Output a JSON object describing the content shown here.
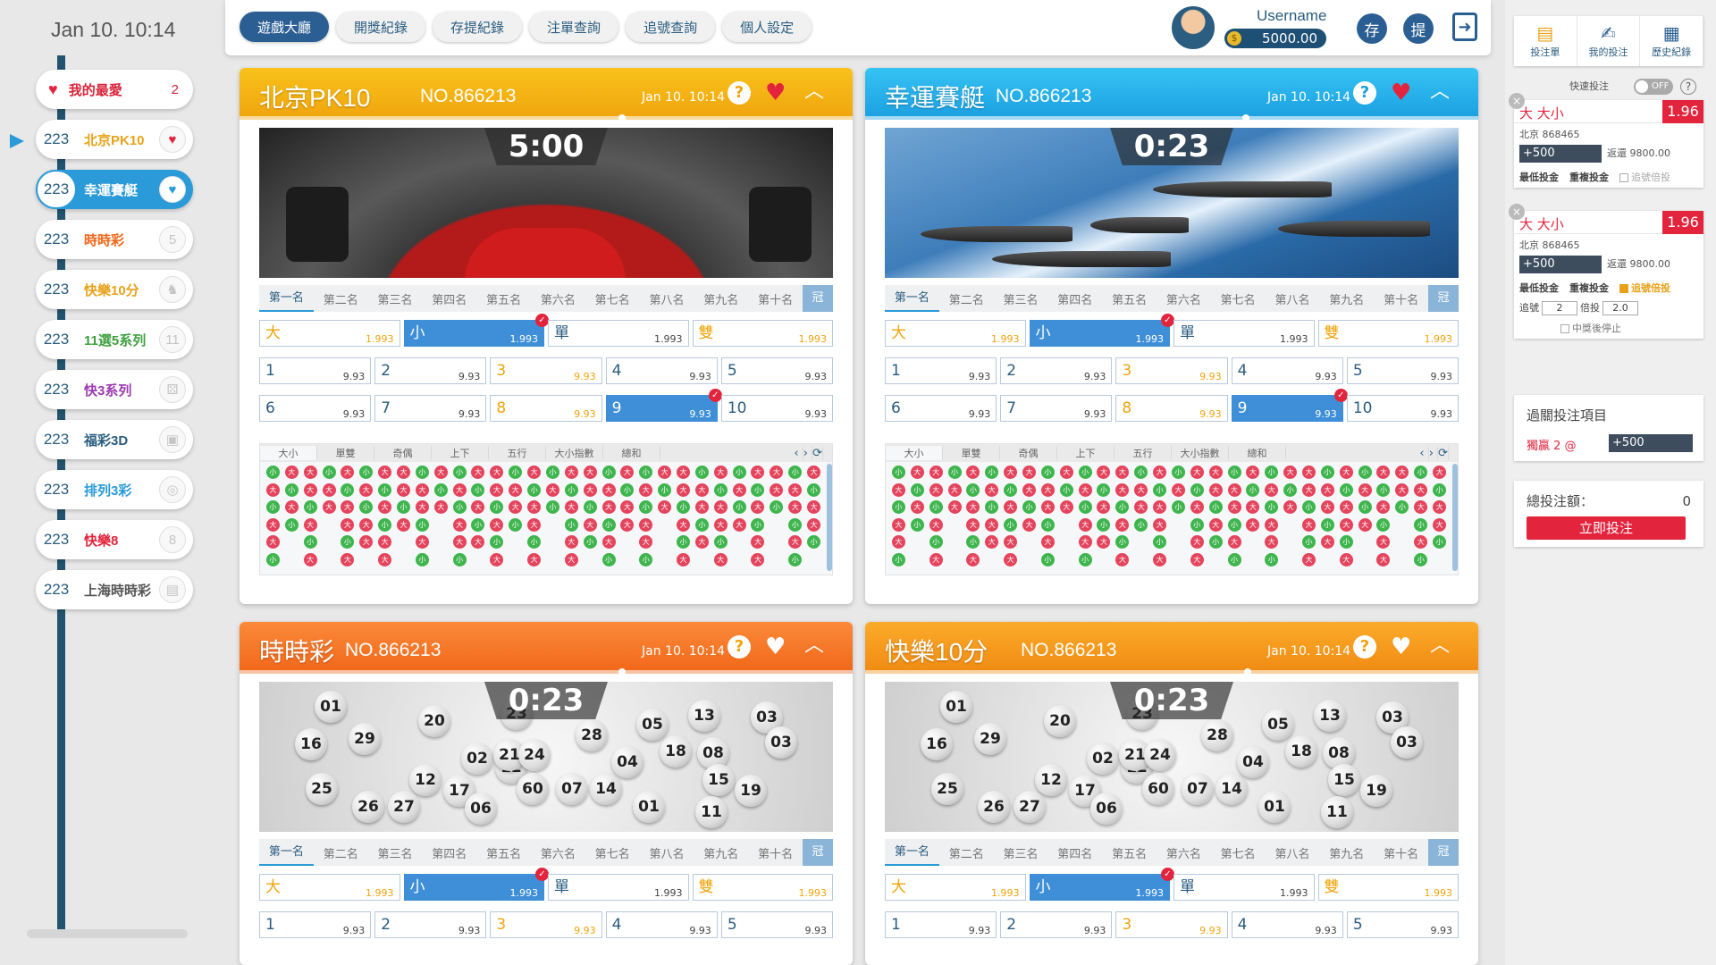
{
  "clock": "Jan 10. 10:14",
  "sidebar": {
    "favorite": {
      "label": "我的最愛",
      "count": "2"
    },
    "items": [
      {
        "count": "223",
        "label": "北京PK10",
        "color": "#e7a21a",
        "icon": "heart-icon",
        "glyph": "♥"
      },
      {
        "count": "223",
        "label": "幸運賽艇",
        "color": "#ffffff",
        "icon": "heart-icon",
        "glyph": "♥"
      },
      {
        "count": "223",
        "label": "時時彩",
        "color": "#f16618",
        "icon": "lottery-ball-icon",
        "glyph": "5"
      },
      {
        "count": "223",
        "label": "快樂10分",
        "color": "#e7a21a",
        "icon": "horse-icon",
        "glyph": "♞"
      },
      {
        "count": "223",
        "label": "11選5系列",
        "color": "#3fa040",
        "icon": "eleven-icon",
        "glyph": "11"
      },
      {
        "count": "223",
        "label": "快3系列",
        "color": "#9c3bb0",
        "icon": "dice-icon",
        "glyph": "⚄"
      },
      {
        "count": "223",
        "label": "福彩3D",
        "color": "#2a5d80",
        "icon": "cube-3d-icon",
        "glyph": "▣"
      },
      {
        "count": "223",
        "label": "排列3彩",
        "color": "#2a9ad8",
        "icon": "circle-icon",
        "glyph": "◎"
      },
      {
        "count": "223",
        "label": "快樂8",
        "color": "#e3243d",
        "icon": "eight-ball-icon",
        "glyph": "8"
      },
      {
        "count": "223",
        "label": "上海時時彩",
        "color": "#555555",
        "icon": "shanghai-icon",
        "glyph": "▤"
      }
    ]
  },
  "nav": {
    "tabs": [
      "遊戲大廳",
      "開獎紀錄",
      "存提紀錄",
      "注單查詢",
      "追號查詢",
      "個人設定"
    ],
    "username": "Username",
    "balance": "5000.00",
    "deposit": "存",
    "withdraw": "提"
  },
  "ranks": [
    "第一名",
    "第二名",
    "第三名",
    "第四名",
    "第五名",
    "第六名",
    "第七名",
    "第八名",
    "第九名",
    "第十名",
    "冠"
  ],
  "bets": {
    "row1": [
      {
        "label": "大",
        "odds": "1.993"
      },
      {
        "label": "小",
        "odds": "1.993"
      },
      {
        "label": "單",
        "odds": "1.993"
      },
      {
        "label": "雙",
        "odds": "1.993"
      }
    ],
    "row2": [
      {
        "label": "1",
        "odds": "9.93"
      },
      {
        "label": "2",
        "odds": "9.93"
      },
      {
        "label": "3",
        "odds": "9.93"
      },
      {
        "label": "4",
        "odds": "9.93"
      },
      {
        "label": "5",
        "odds": "9.93"
      }
    ],
    "row3": [
      {
        "label": "6",
        "odds": "9.93"
      },
      {
        "label": "7",
        "odds": "9.93"
      },
      {
        "label": "8",
        "odds": "9.93"
      },
      {
        "label": "9",
        "odds": "9.93"
      },
      {
        "label": "10",
        "odds": "9.93"
      }
    ]
  },
  "trend_tabs": [
    "大小",
    "單雙",
    "奇偶",
    "上下",
    "五行",
    "大小指數",
    "總和"
  ],
  "trend_glyphs": {
    "big": "大",
    "small": "小"
  },
  "panels": [
    {
      "title": "北京PK10",
      "no": "NO.866213",
      "time": "Jan 10. 10:14",
      "timer": "5:00",
      "theme": "yellow",
      "video": "race-car",
      "fav": true
    },
    {
      "title": "幸運賽艇",
      "no": "NO.866213",
      "time": "Jan 10. 10:14",
      "timer": "0:23",
      "theme": "blue",
      "video": "speedboats",
      "fav": true
    },
    {
      "title": "時時彩",
      "no": "NO.866213",
      "time": "Jan 10. 10:14",
      "timer": "0:23",
      "theme": "orange",
      "video": "lottery-balls",
      "fav": false
    },
    {
      "title": "快樂10分",
      "no": "NO.866213",
      "time": "Jan 10. 10:14",
      "timer": "0:23",
      "theme": "amber",
      "video": "lottery-balls",
      "fav": false
    }
  ],
  "balls": [
    "01",
    "16",
    "29",
    "20",
    "12",
    "23",
    "28",
    "05",
    "13",
    "03",
    "03",
    "02",
    "21",
    "24",
    "18",
    "08",
    "25",
    "12",
    "17",
    "60",
    "07",
    "14",
    "04",
    "15",
    "19",
    "26",
    "27",
    "06",
    "01",
    "11"
  ],
  "slip": {
    "tabs": [
      {
        "label": "投注單",
        "icon": "bet-slip-icon",
        "glyph": "▤"
      },
      {
        "label": "我的投注",
        "icon": "hand-bet-icon",
        "glyph": "✍"
      },
      {
        "label": "歷史紀錄",
        "icon": "history-icon",
        "glyph": "▦"
      }
    ],
    "quick_label": "快速投注",
    "quick_state": "OFF",
    "items": [
      {
        "name": "大 大小",
        "odds": "1.96",
        "game": "北京 868465",
        "amount": "+500",
        "return": "返還 9800.00",
        "min": "最低投金",
        "repeat": "重複投金",
        "chase": "追號倍投"
      },
      {
        "name": "大 大小",
        "odds": "1.96",
        "game": "北京 868465",
        "amount": "+500",
        "return": "返還 9800.00",
        "min": "最低投金",
        "repeat": "重複投金",
        "chase": "追號倍投",
        "chase_label": "追號",
        "chase_val": "2",
        "mult_label": "倍投",
        "mult_val": "2.0",
        "stop_label": "中獎後停止"
      }
    ],
    "pass_title": "過關投注項目",
    "pass_name": "獨贏 2 @",
    "pass_amount": "+500",
    "total_label": "總投注額：",
    "total_value": "0",
    "submit": "立即投注"
  }
}
